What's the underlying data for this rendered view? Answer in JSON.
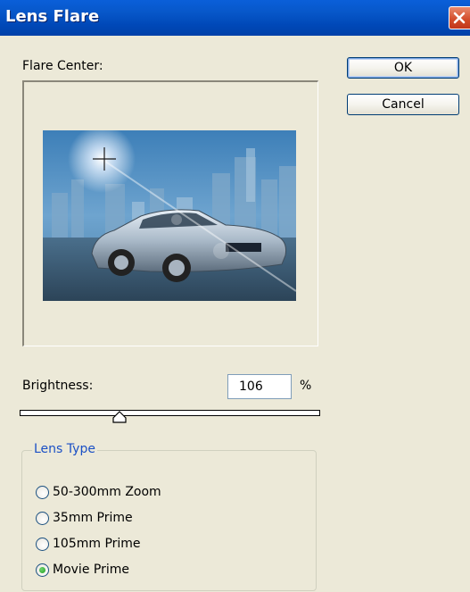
{
  "window": {
    "title": "Lens Flare"
  },
  "preview": {
    "label": "Flare Center:"
  },
  "buttons": {
    "ok": "OK",
    "cancel": "Cancel"
  },
  "brightness": {
    "label": "Brightness:",
    "value": "106",
    "unit": "%"
  },
  "lens_type": {
    "legend": "Lens Type",
    "options": [
      {
        "label": "50-300mm Zoom",
        "selected": false
      },
      {
        "label": "35mm Prime",
        "selected": false
      },
      {
        "label": "105mm Prime",
        "selected": false
      },
      {
        "label": "Movie Prime",
        "selected": true
      }
    ]
  },
  "colors": {
    "titlebar": "#0054e3",
    "dialog_bg": "#ece9d8",
    "group_legend": "#1b50c5",
    "radio_selected": "#21a121"
  },
  "icons": {
    "close": "close-icon",
    "crosshair": "crosshair-icon"
  }
}
